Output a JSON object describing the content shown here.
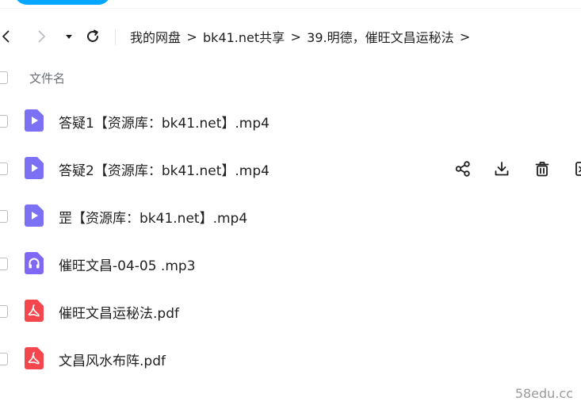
{
  "colors": {
    "accent": "#06a7ff",
    "video_icon": "#7c71f5",
    "audio_icon": "#8068f5",
    "pdf_icon": "#f4474d",
    "text": "#1f1f1f",
    "muted": "#6b6f76"
  },
  "toolbar": {
    "back_icon": "chevron-left-icon",
    "forward_icon": "chevron-right-icon",
    "dropdown_icon": "caret-down-icon",
    "refresh_icon": "refresh-icon"
  },
  "breadcrumb": {
    "items": [
      "我的网盘",
      "bk41.net共享",
      "39.明德，催旺文昌运秘法"
    ],
    "separator": ">"
  },
  "list": {
    "header_label": "文件名",
    "files": [
      {
        "name": "答疑1【资源库：bk41.net】.mp4",
        "type": "video"
      },
      {
        "name": "答疑2【资源库：bk41.net】.mp4",
        "type": "video"
      },
      {
        "name": "罡【资源库：bk41.net】.mp4",
        "type": "video"
      },
      {
        "name": "催旺文昌-04-05 .mp3",
        "type": "audio"
      },
      {
        "name": "催旺文昌运秘法.pdf",
        "type": "pdf"
      },
      {
        "name": "文昌风水布阵.pdf",
        "type": "pdf"
      }
    ],
    "hovered_row_actions": [
      "share-icon",
      "download-icon",
      "delete-icon",
      "more-icon"
    ]
  },
  "watermark": "58edu.cc"
}
